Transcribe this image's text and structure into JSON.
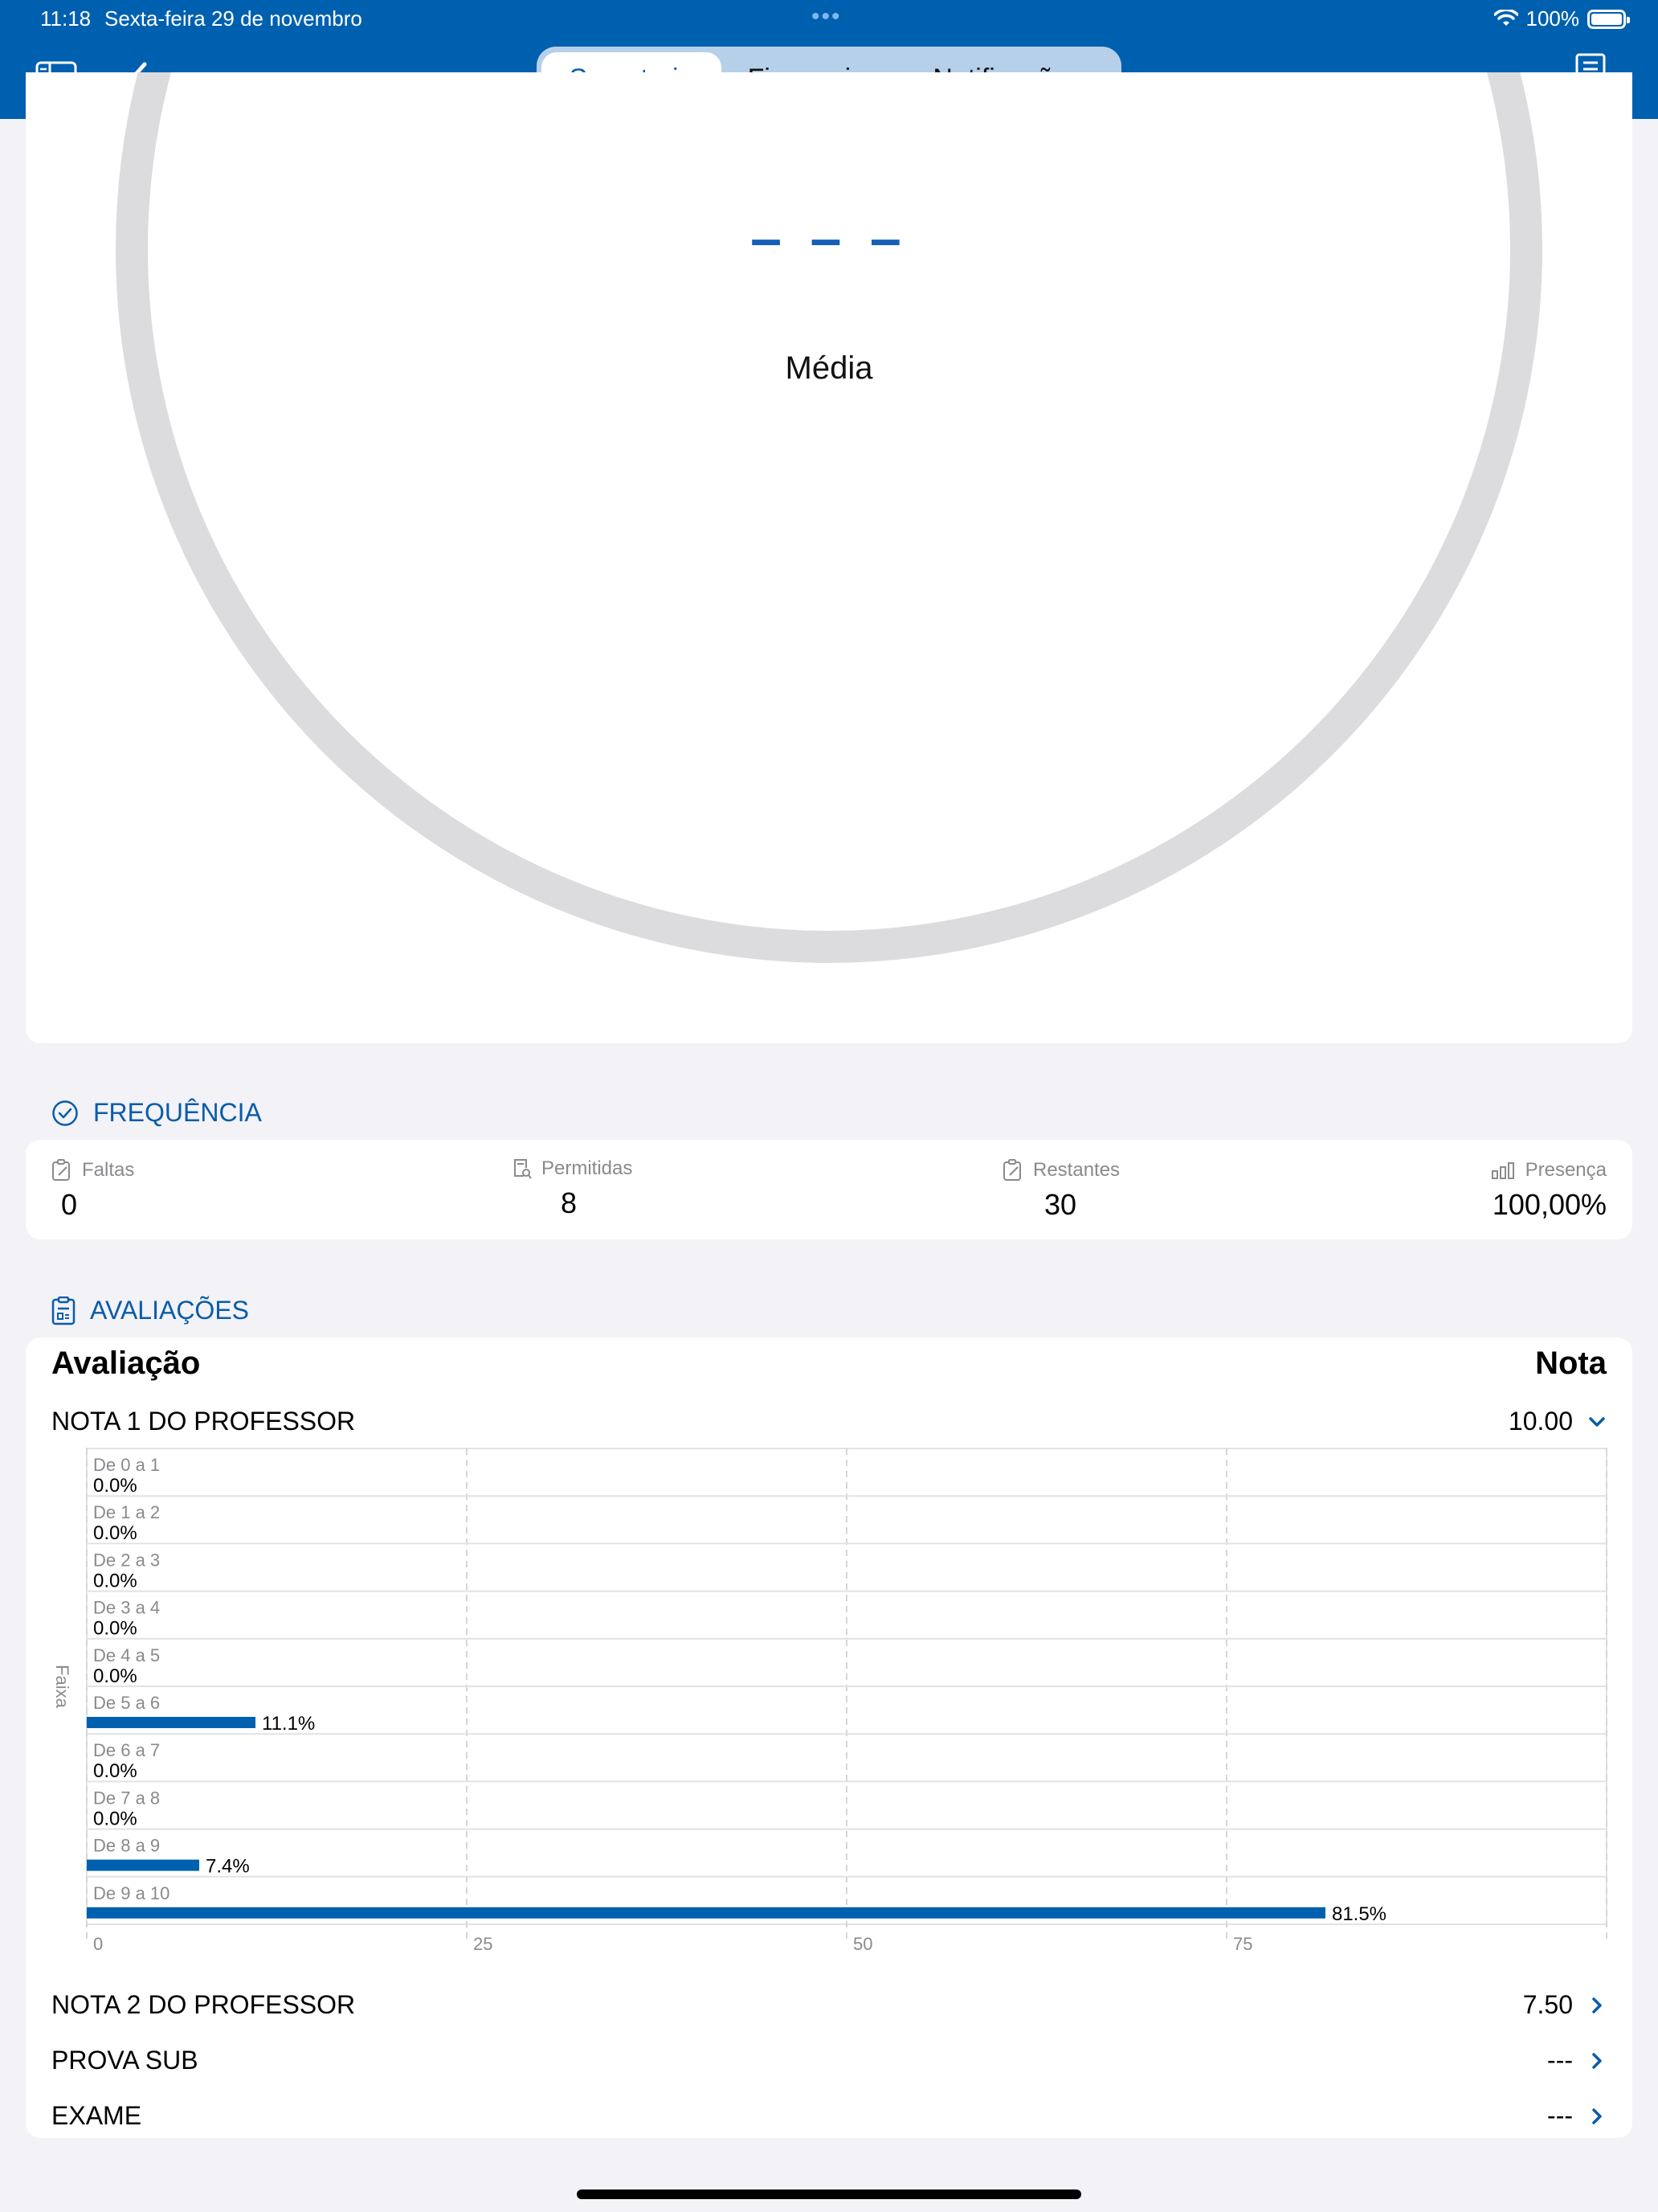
{
  "status_bar": {
    "time": "11:18",
    "date": "Sexta-feira 29 de novembro",
    "dots": "•••",
    "battery": "100%"
  },
  "header": {
    "tabs": [
      {
        "label": "Secretaria",
        "active": true
      },
      {
        "label": "Financeiro",
        "active": false
      },
      {
        "label": "Notificações",
        "active": false
      }
    ],
    "accent_color": "#0060b0",
    "icons": [
      "sidebar-icon",
      "back-chevron-icon",
      "document-search-icon"
    ]
  },
  "media": {
    "value": "– – –",
    "label": "Média"
  },
  "frequencia": {
    "title": "FREQUÊNCIA",
    "items": [
      {
        "label": "Faltas",
        "value": "0",
        "icon": "clipboard-edit-icon"
      },
      {
        "label": "Permitidas",
        "value": "8",
        "icon": "document-search-icon"
      },
      {
        "label": "Restantes",
        "value": "30",
        "icon": "clipboard-edit-icon"
      },
      {
        "label": "Presença",
        "value": "100,00%",
        "icon": "bar-chart-icon"
      }
    ]
  },
  "avaliacoes": {
    "title": "AVALIAÇÕES",
    "col_evaluation": "Avaliação",
    "col_grade": "Nota",
    "rows": [
      {
        "name": "NOTA 1 DO PROFESSOR",
        "grade": "10.00",
        "expanded": true
      },
      {
        "name": "NOTA 2 DO PROFESSOR",
        "grade": "7.50",
        "expanded": false
      },
      {
        "name": "PROVA SUB",
        "grade": "---",
        "expanded": false
      },
      {
        "name": "EXAME",
        "grade": "---",
        "expanded": false
      }
    ]
  },
  "chart_data": {
    "type": "bar",
    "orientation": "horizontal",
    "ylabel": "Faixa",
    "xlabel": "",
    "xlim": [
      0,
      100
    ],
    "xticks": [
      "0",
      "25",
      "50",
      "75"
    ],
    "grid": true,
    "categories": [
      "De 0 a 1",
      "De 1 a 2",
      "De 2 a 3",
      "De 3 a 4",
      "De 4 a 5",
      "De 5 a 6",
      "De 6 a 7",
      "De 7 a 8",
      "De 8 a 9",
      "De 9 a 10"
    ],
    "values": [
      0.0,
      0.0,
      0.0,
      0.0,
      0.0,
      11.1,
      0.0,
      0.0,
      7.4,
      81.5
    ],
    "value_labels": [
      "0.0%",
      "0.0%",
      "0.0%",
      "0.0%",
      "0.0%",
      "11.1%",
      "0.0%",
      "0.0%",
      "7.4%",
      "81.5%"
    ],
    "bar_color": "#0060b0"
  }
}
